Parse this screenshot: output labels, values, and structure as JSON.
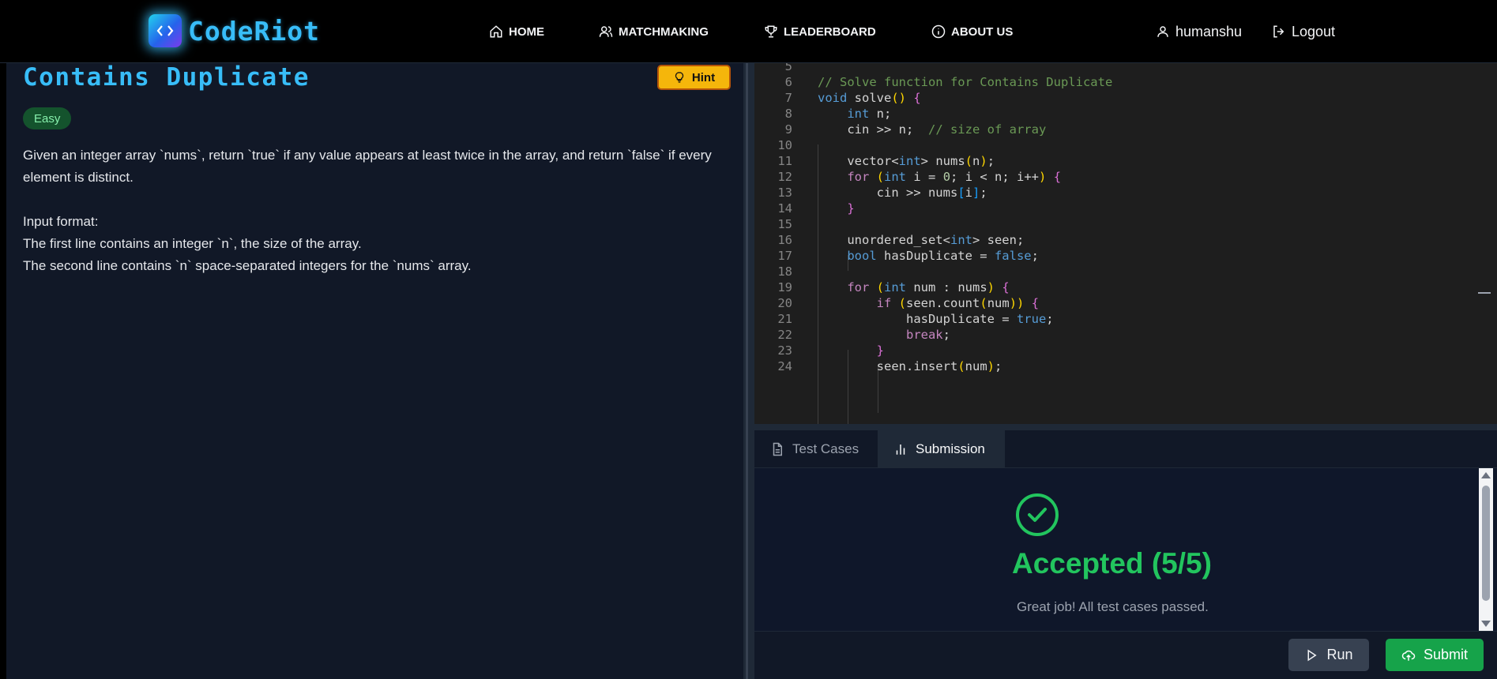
{
  "navbar": {
    "brand_name": "CodeRiot",
    "brand_icon_glyph": "<>",
    "items": [
      {
        "label": "HOME",
        "icon": "home-icon"
      },
      {
        "label": "MATCHMAKING",
        "icon": "users-icon"
      },
      {
        "label": "LEADERBOARD",
        "icon": "trophy-icon"
      },
      {
        "label": "ABOUT US",
        "icon": "info-icon"
      }
    ],
    "username": "humanshu",
    "logout_label": "Logout"
  },
  "problem": {
    "title": "Contains Duplicate",
    "hint_label": "Hint",
    "difficulty": "Easy",
    "description": "Given an integer array `nums`, return `true` if any value appears at least twice in the array, and return `false` if every element is distinct.\n\nInput format:\nThe first line contains an integer `n`, the size of the array.\nThe second line contains `n` space-separated integers for the `nums` array."
  },
  "editor": {
    "line_numbers": [
      "5",
      "6",
      "7",
      "8",
      "9",
      "10",
      "11",
      "12",
      "13",
      "14",
      "15",
      "16",
      "17",
      "18",
      "19",
      "20",
      "21",
      "22",
      "23",
      "24"
    ],
    "code_lines": [
      "",
      "// Solve function for Contains Duplicate",
      "void solve() {",
      "    int n;",
      "    cin >> n;  // size of array",
      "",
      "    vector<int> nums(n);",
      "    for (int i = 0; i < n; i++) {",
      "        cin >> nums[i];",
      "    }",
      "",
      "    unordered_set<int> seen;",
      "    bool hasDuplicate = false;",
      "",
      "    for (int num : nums) {",
      "        if (seen.count(num)) {",
      "            hasDuplicate = true;",
      "            break;",
      "        }",
      "        seen.insert(num);"
    ]
  },
  "tabs": {
    "test_cases_label": "Test Cases",
    "submission_label": "Submission",
    "active": "Submission"
  },
  "result": {
    "verdict": "Accepted (5/5)",
    "message": "Great job! All test cases passed.",
    "status_color": "#22c55e"
  },
  "actions": {
    "run_label": "Run",
    "submit_label": "Submit"
  }
}
